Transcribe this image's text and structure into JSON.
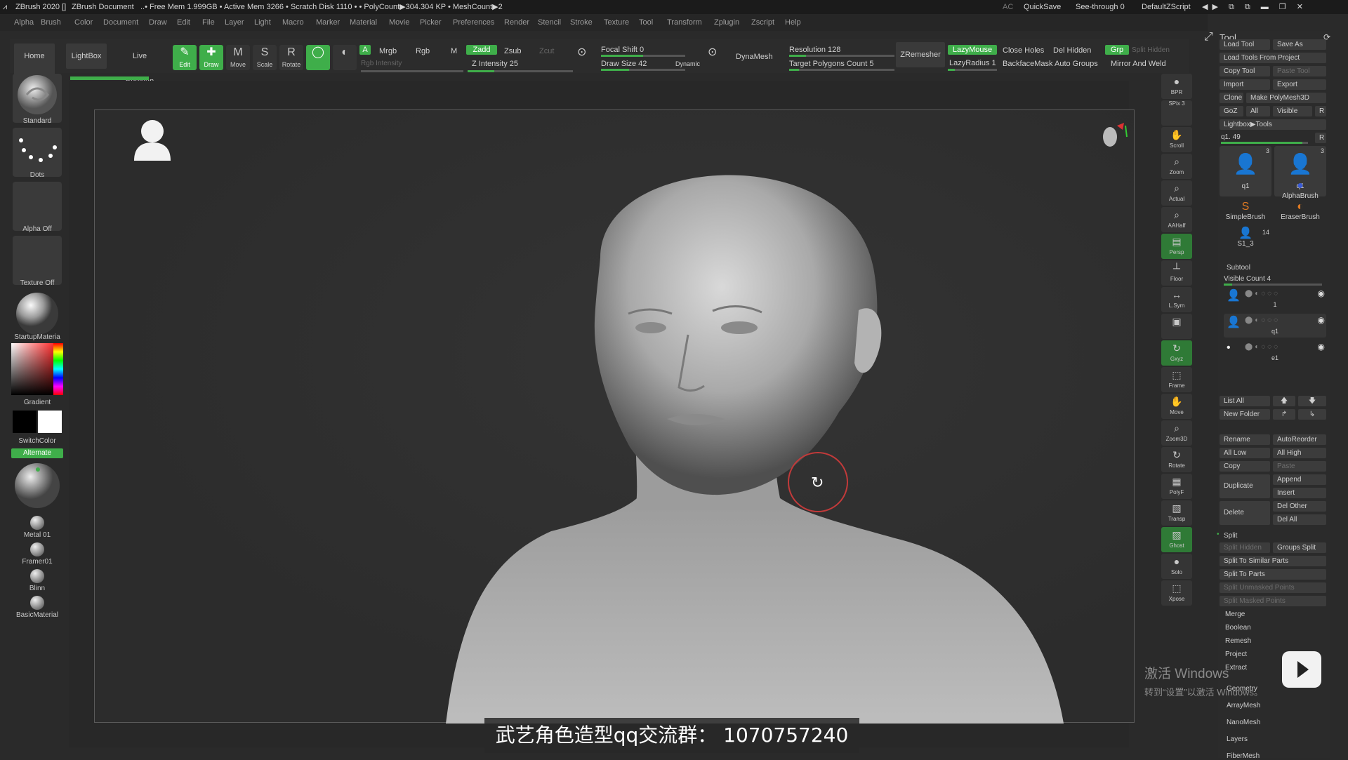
{
  "titlebar": {
    "app": "ZBrush 2020 []",
    "document": "ZBrush Document",
    "stats": "..• Free Mem 1.999GB • Active Mem 3266 • Scratch Disk 1110 •  • PolyCount▶304.304 KP  • MeshCount▶2",
    "ac": "AC",
    "quicksave": "QuickSave",
    "seethrough": "See-through  0",
    "zscript": "DefaultZScript"
  },
  "menu": [
    "Alpha",
    "Brush",
    "Color",
    "Document",
    "Draw",
    "Edit",
    "File",
    "Layer",
    "Light",
    "Macro",
    "Marker",
    "Material",
    "Movie",
    "Picker",
    "Preferences",
    "Render",
    "Stencil",
    "Stroke",
    "Texture",
    "Tool",
    "Transform",
    "Zplugin",
    "Zscript",
    "Help"
  ],
  "toolbar": {
    "home": "Home Page",
    "lightbox": "LightBox",
    "liveboolean": "Live Boolean",
    "edit": "Edit",
    "draw": "Draw",
    "move": "Move",
    "scale": "Scale",
    "rotate": "Rotate",
    "a": "A",
    "mrgb": "Mrgb",
    "rgb": "Rgb",
    "m": "M",
    "rgb_intensity": "Rgb Intensity",
    "zadd": "Zadd",
    "zsub": "Zsub",
    "zcut": "Zcut",
    "z_intensity": "Z Intensity 25",
    "focal_shift": "Focal Shift 0",
    "draw_size": "Draw Size 42",
    "dynamic": "Dynamic",
    "dynamesh": "DynaMesh",
    "resolution": "Resolution 128",
    "target_polys": "Target Polygons Count 5",
    "zremesher": "ZRemesher",
    "lazymouse": "LazyMouse",
    "lazyradius": "LazyRadius 1",
    "close_holes": "Close Holes",
    "backface": "BackfaceMask",
    "del_hidden": "Del Hidden",
    "auto_groups": "Auto Groups",
    "grp": "Grp",
    "split_hidden": "Split Hidden",
    "mirror_weld": "Mirror And Weld"
  },
  "left": {
    "brush": "Standard",
    "stroke": "Dots",
    "alpha": "Alpha Off",
    "texture": "Texture Off",
    "material": "StartupMateria",
    "gradient": "Gradient",
    "switchcolor": "SwitchColor",
    "alternate": "Alternate",
    "materials": [
      "Metal 01",
      "Framer01",
      "Blinn",
      "BasicMaterial"
    ]
  },
  "righttools": [
    {
      "name": "bpr",
      "label": "BPR",
      "glyph": "●"
    },
    {
      "name": "spix",
      "label": "SPix 3",
      "glyph": ""
    },
    {
      "name": "scroll",
      "label": "Scroll",
      "glyph": "✋"
    },
    {
      "name": "zoom",
      "label": "Zoom",
      "glyph": "⌕"
    },
    {
      "name": "actual",
      "label": "Actual",
      "glyph": "⌕"
    },
    {
      "name": "aahalf",
      "label": "AAHalf",
      "glyph": "⌕"
    },
    {
      "name": "persp",
      "label": "Persp",
      "glyph": "▤"
    },
    {
      "name": "floor",
      "label": "Floor",
      "glyph": "┴"
    },
    {
      "name": "lsym",
      "label": "L.Sym",
      "glyph": "↔"
    },
    {
      "name": "lock",
      "label": "",
      "glyph": "▣"
    },
    {
      "name": "xyz",
      "label": "Gxyz",
      "glyph": "↻"
    },
    {
      "name": "frame",
      "label": "Frame",
      "glyph": "⬚"
    },
    {
      "name": "move",
      "label": "Move",
      "glyph": "✋"
    },
    {
      "name": "zoom3d",
      "label": "Zoom3D",
      "glyph": "⌕"
    },
    {
      "name": "rotate",
      "label": "Rotate",
      "glyph": "↻"
    },
    {
      "name": "polyf",
      "label": "PolyF",
      "glyph": "▦"
    },
    {
      "name": "transp",
      "label": "Transp",
      "glyph": "▧"
    },
    {
      "name": "ghost",
      "label": "Ghost",
      "glyph": "▧"
    },
    {
      "name": "solo",
      "label": "Solo",
      "glyph": "●"
    },
    {
      "name": "xpose",
      "label": "Xpose",
      "glyph": "⬚"
    }
  ],
  "panel": {
    "title": "Tool",
    "load_tool": "Load Tool",
    "save_as": "Save As",
    "load_from_project": "Load Tools From Project",
    "copy_tool": "Copy Tool",
    "paste_tool": "Paste Tool",
    "import": "Import",
    "export": "Export",
    "clone": "Clone",
    "make_polymesh": "Make PolyMesh3D",
    "goz": "GoZ",
    "all": "All",
    "visible": "Visible",
    "r": "R",
    "lightbox_tools": "Lightbox▶Tools",
    "current_tool": "q1. 49",
    "thumbs": [
      {
        "label": "q1",
        "count": "3"
      },
      {
        "label": "q1",
        "count": "3"
      },
      {
        "label": "AlphaBrush",
        "count": ""
      },
      {
        "label": "SimpleBrush",
        "count": ""
      },
      {
        "label": "EraserBrush",
        "count": ""
      },
      {
        "label": "S1_3",
        "count": "14"
      }
    ],
    "subtool": "Subtool",
    "visible_count": "Visible Count 4",
    "subtools": [
      "1",
      "q1",
      "e1"
    ],
    "list_all": "List All",
    "new_folder": "New Folder",
    "rename": "Rename",
    "autoreorder": "AutoReorder",
    "all_low": "All Low",
    "all_high": "All High",
    "copy": "Copy",
    "paste": "Paste",
    "duplicate": "Duplicate",
    "append": "Append",
    "insert": "Insert",
    "delete": "Delete",
    "del_other": "Del Other",
    "del_all": "Del All",
    "split": "Split",
    "split_hidden": "Split Hidden",
    "groups_split": "Groups Split",
    "split_similar": "Split To Similar Parts",
    "split_parts": "Split To Parts",
    "split_unmasked": "Split Unmasked Points",
    "split_masked": "Split Masked Points",
    "merge": "Merge",
    "boolean": "Boolean",
    "remesh": "Remesh",
    "project": "Project",
    "extract": "Extract",
    "geometry": "Geometry",
    "arraymesh": "ArrayMesh",
    "nanomesh": "NanoMesh",
    "layers": "Layers",
    "fibermesh": "FiberMesh"
  },
  "caption": "武艺角色造型qq交流群： 1070757240",
  "watermark": {
    "line1": "激活 Windows",
    "line2": "转到“设置”以激活 Windows。"
  },
  "colors": {
    "accent": "#3fae4a",
    "bg": "#2a2a2a",
    "brush_cursor": "#c23a3a"
  }
}
